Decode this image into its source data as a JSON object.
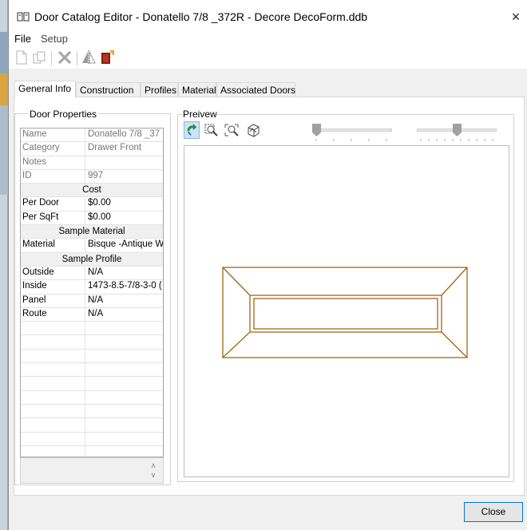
{
  "window": {
    "title": "Door Catalog Editor - Donatello 7/8 _372R - Decore DecoForm.ddb",
    "close_glyph": "×"
  },
  "menu": [
    "File",
    "Setup"
  ],
  "toolbar": {
    "icons": [
      "new-icon",
      "copy-icon",
      "delete-icon",
      "mirror-icon",
      "door-color-icon"
    ]
  },
  "tabs": [
    "General Info",
    "Construction",
    "Profiles",
    "Material",
    "Associated Doors"
  ],
  "active_tab": "General Info",
  "door_properties": {
    "legend": "Door Properties",
    "rows": [
      {
        "k": "Name",
        "v": "Donatello 7/8 _37",
        "style": "gray"
      },
      {
        "k": "Category",
        "v": "Drawer Front",
        "style": "gray"
      },
      {
        "k": "Notes",
        "v": "",
        "style": "gray"
      },
      {
        "k": "ID",
        "v": "997",
        "style": "gray"
      },
      {
        "section": "Cost"
      },
      {
        "k": "Per Door",
        "v": "$0.00"
      },
      {
        "k": "Per SqFt",
        "v": "$0.00"
      },
      {
        "section": "Sample Material"
      },
      {
        "k": "Material",
        "v": "Bisque -Antique W"
      },
      {
        "section": "Sample Profile"
      },
      {
        "k": "Outside",
        "v": "N/A"
      },
      {
        "k": "Inside",
        "v": "1473-8.5-7/8-3-0 ("
      },
      {
        "k": "Panel",
        "v": "N/A"
      },
      {
        "k": "Route",
        "v": "N/A"
      }
    ],
    "empty_rows": 12
  },
  "preview": {
    "legend": "Preivew",
    "tools": [
      "rotate-icon",
      "zoom-window-icon",
      "zoom-extents-icon",
      "3d-view-icon"
    ],
    "slider1_level": 0.0,
    "slider2_level": 0.5,
    "door_color": "#a0661a"
  },
  "buttons": {
    "close": "Close"
  }
}
